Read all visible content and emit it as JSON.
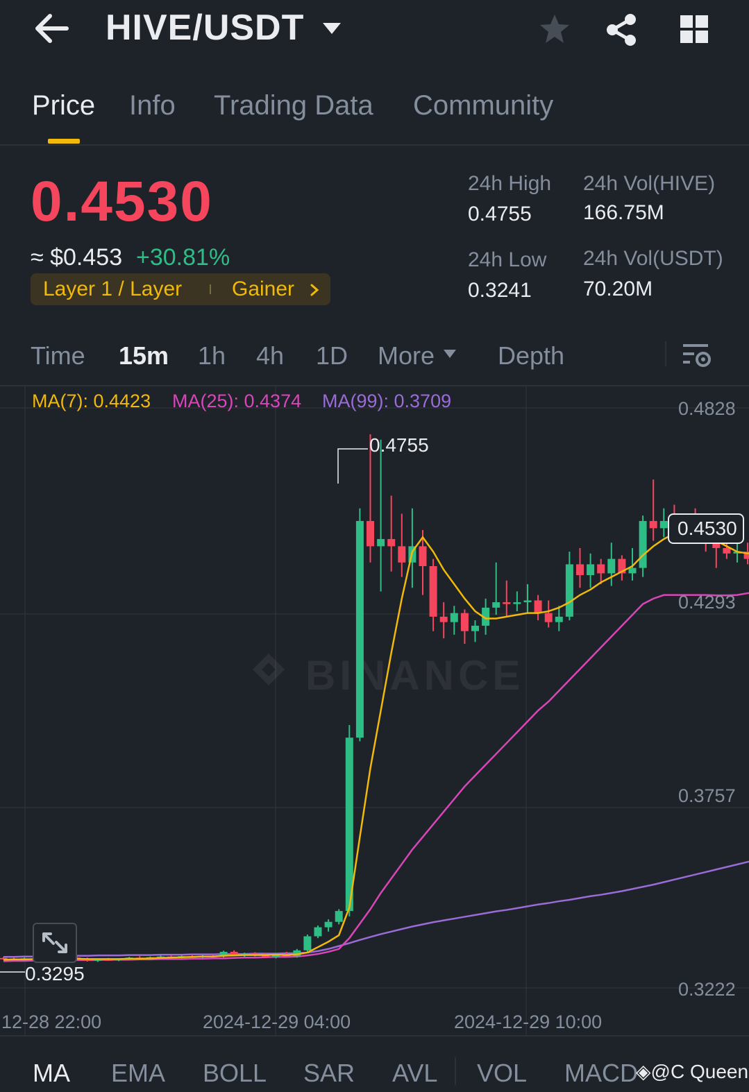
{
  "header": {
    "pair": "HIVE/USDT",
    "icons": [
      "back-arrow-icon",
      "caret-down-icon",
      "star-icon",
      "share-icon",
      "grid-icon"
    ]
  },
  "tabs": [
    {
      "label": "Price",
      "active": true
    },
    {
      "label": "Info",
      "active": false
    },
    {
      "label": "Trading Data",
      "active": false
    },
    {
      "label": "Community",
      "active": false
    }
  ],
  "price": {
    "last": "0.4530",
    "usd": "≈ $0.453",
    "change": "+30.81%",
    "tag1": "Layer 1 / Layer",
    "tag2": "Gainer"
  },
  "stats": {
    "high_label": "24h High",
    "high_value": "0.4755",
    "low_label": "24h Low",
    "low_value": "0.3241",
    "vol_base_label": "24h Vol(HIVE)",
    "vol_base_value": "166.75M",
    "vol_quote_label": "24h Vol(USDT)",
    "vol_quote_value": "70.20M"
  },
  "intervals": {
    "time": "Time",
    "m15": "15m",
    "h1": "1h",
    "h4": "4h",
    "d1": "1D",
    "more": "More",
    "depth": "Depth",
    "active": "15m"
  },
  "chart": {
    "ma7": "MA(7): 0.4423",
    "ma25": "MA(25): 0.4374",
    "ma99": "MA(99): 0.3709",
    "y_labels": [
      "0.4828",
      "0.4293",
      "0.3757",
      "0.3222"
    ],
    "x_labels": [
      "12-28 22:00",
      "2024-12-29 04:00",
      "2024-12-29 10:00"
    ],
    "current_price": "0.4530",
    "high_marker": "0.4755",
    "low_marker": "0.3295",
    "watermark": "BINANCE"
  },
  "chart_data": {
    "type": "candlestick",
    "interval": "15m",
    "ylim": [
      0.3222,
      0.4828
    ],
    "colors": {
      "up": "#2ebd85",
      "down": "#f6465d",
      "ma7": "#f0b90b",
      "ma25": "#d946b9",
      "ma99": "#9b6bd6"
    },
    "candles": [
      [
        0.3305,
        0.3308,
        0.33,
        0.3303
      ],
      [
        0.3303,
        0.3307,
        0.3299,
        0.3301
      ],
      [
        0.3301,
        0.3306,
        0.3298,
        0.3304
      ],
      [
        0.3304,
        0.3309,
        0.33,
        0.3302
      ],
      [
        0.3302,
        0.3306,
        0.3297,
        0.3299
      ],
      [
        0.3299,
        0.3305,
        0.3296,
        0.3303
      ],
      [
        0.3303,
        0.3308,
        0.33,
        0.3306
      ],
      [
        0.3306,
        0.331,
        0.33,
        0.3302
      ],
      [
        0.3302,
        0.3306,
        0.3295,
        0.3297
      ],
      [
        0.3297,
        0.3303,
        0.3294,
        0.3301
      ],
      [
        0.3301,
        0.3305,
        0.3297,
        0.3299
      ],
      [
        0.3299,
        0.3303,
        0.3296,
        0.3302
      ],
      [
        0.3302,
        0.3308,
        0.33,
        0.3306
      ],
      [
        0.3306,
        0.331,
        0.3302,
        0.3304
      ],
      [
        0.3304,
        0.3309,
        0.3301,
        0.3307
      ],
      [
        0.3307,
        0.3312,
        0.3303,
        0.3309
      ],
      [
        0.3309,
        0.3313,
        0.3305,
        0.3307
      ],
      [
        0.3307,
        0.3312,
        0.3304,
        0.331
      ],
      [
        0.331,
        0.3314,
        0.3306,
        0.3308
      ],
      [
        0.3308,
        0.3313,
        0.3305,
        0.3311
      ],
      [
        0.3311,
        0.3316,
        0.3307,
        0.3309
      ],
      [
        0.3309,
        0.3325,
        0.3306,
        0.3322
      ],
      [
        0.3322,
        0.3326,
        0.331,
        0.3314
      ],
      [
        0.3314,
        0.332,
        0.3308,
        0.3317
      ],
      [
        0.3317,
        0.3321,
        0.3309,
        0.3312
      ],
      [
        0.3312,
        0.3318,
        0.3305,
        0.3308
      ],
      [
        0.3308,
        0.3319,
        0.3304,
        0.3316
      ],
      [
        0.3316,
        0.3322,
        0.3306,
        0.331
      ],
      [
        0.331,
        0.333,
        0.3306,
        0.3326
      ],
      [
        0.3326,
        0.337,
        0.3322,
        0.3365
      ],
      [
        0.3365,
        0.3395,
        0.336,
        0.339
      ],
      [
        0.339,
        0.3412,
        0.3378,
        0.3405
      ],
      [
        0.3405,
        0.344,
        0.3398,
        0.3435
      ],
      [
        0.3435,
        0.395,
        0.342,
        0.3915
      ],
      [
        0.3915,
        0.455,
        0.3905,
        0.4515
      ],
      [
        0.4515,
        0.4755,
        0.44,
        0.4445
      ],
      [
        0.4445,
        0.474,
        0.432,
        0.4465
      ],
      [
        0.4465,
        0.4585,
        0.4375,
        0.4445
      ],
      [
        0.4445,
        0.4535,
        0.436,
        0.44
      ],
      [
        0.44,
        0.455,
        0.433,
        0.4445
      ],
      [
        0.4445,
        0.449,
        0.431,
        0.439
      ],
      [
        0.439,
        0.441,
        0.421,
        0.425
      ],
      [
        0.425,
        0.429,
        0.419,
        0.4235
      ],
      [
        0.4235,
        0.428,
        0.42,
        0.426
      ],
      [
        0.426,
        0.427,
        0.4175,
        0.421
      ],
      [
        0.421,
        0.424,
        0.418,
        0.4225
      ],
      [
        0.4225,
        0.43,
        0.42,
        0.4275
      ],
      [
        0.4275,
        0.44,
        0.4255,
        0.429
      ],
      [
        0.429,
        0.435,
        0.425,
        0.4285
      ],
      [
        0.4285,
        0.432,
        0.4265,
        0.429
      ],
      [
        0.429,
        0.434,
        0.426,
        0.4295
      ],
      [
        0.4295,
        0.431,
        0.424,
        0.426
      ],
      [
        0.426,
        0.4295,
        0.422,
        0.4235
      ],
      [
        0.4235,
        0.428,
        0.421,
        0.425
      ],
      [
        0.425,
        0.443,
        0.424,
        0.4395
      ],
      [
        0.4395,
        0.444,
        0.433,
        0.4365
      ],
      [
        0.4365,
        0.4425,
        0.433,
        0.4395
      ],
      [
        0.4395,
        0.441,
        0.434,
        0.437
      ],
      [
        0.437,
        0.4455,
        0.4335,
        0.441
      ],
      [
        0.441,
        0.442,
        0.435,
        0.437
      ],
      [
        0.437,
        0.444,
        0.435,
        0.4385
      ],
      [
        0.4385,
        0.453,
        0.436,
        0.4515
      ],
      [
        0.4515,
        0.463,
        0.446,
        0.4495
      ],
      [
        0.4495,
        0.455,
        0.447,
        0.4515
      ],
      [
        0.4515,
        0.456,
        0.4465,
        0.4495
      ],
      [
        0.4495,
        0.453,
        0.447,
        0.4505
      ],
      [
        0.4505,
        0.455,
        0.4485,
        0.449
      ],
      [
        0.449,
        0.452,
        0.443,
        0.446
      ],
      [
        0.446,
        0.448,
        0.4385,
        0.444
      ],
      [
        0.444,
        0.447,
        0.441,
        0.4425
      ],
      [
        0.4425,
        0.446,
        0.44,
        0.443
      ],
      [
        0.443,
        0.4455,
        0.4395,
        0.441
      ],
      [
        0.441,
        0.445,
        0.439,
        0.4435
      ],
      [
        0.4435,
        0.453,
        0.442,
        0.4465
      ],
      [
        0.4465,
        0.449,
        0.442,
        0.444
      ],
      [
        0.444,
        0.451,
        0.4425,
        0.448
      ],
      [
        0.448,
        0.454,
        0.4465,
        0.453
      ]
    ],
    "ma7_line": [
      0.33,
      0.3301,
      0.3301,
      0.3302,
      0.3302,
      0.3302,
      0.3303,
      0.3303,
      0.3302,
      0.3302,
      0.3302,
      0.3302,
      0.3303,
      0.3303,
      0.3304,
      0.3305,
      0.3306,
      0.3307,
      0.3308,
      0.3309,
      0.3309,
      0.3311,
      0.3312,
      0.3313,
      0.3313,
      0.3313,
      0.3314,
      0.3313,
      0.3315,
      0.332,
      0.3335,
      0.335,
      0.3368,
      0.3445,
      0.364,
      0.383,
      0.399,
      0.415,
      0.43,
      0.443,
      0.447,
      0.443,
      0.438,
      0.434,
      0.43,
      0.4265,
      0.4245,
      0.4245,
      0.425,
      0.4255,
      0.426,
      0.426,
      0.4265,
      0.4275,
      0.429,
      0.431,
      0.4325,
      0.4345,
      0.436,
      0.4375,
      0.439,
      0.442,
      0.4445,
      0.4465,
      0.448,
      0.449,
      0.4485,
      0.4475,
      0.446,
      0.4445,
      0.443,
      0.4425,
      0.443,
      0.4435,
      0.444,
      0.445
    ],
    "ma25_line": [
      0.3296,
      0.3297,
      0.3297,
      0.3298,
      0.3298,
      0.3298,
      0.3299,
      0.3299,
      0.3299,
      0.3299,
      0.33,
      0.33,
      0.33,
      0.3301,
      0.3301,
      0.3302,
      0.3302,
      0.3302,
      0.3303,
      0.3303,
      0.3304,
      0.3304,
      0.3305,
      0.3306,
      0.3306,
      0.3307,
      0.3308,
      0.3308,
      0.3309,
      0.3312,
      0.3316,
      0.3322,
      0.333,
      0.336,
      0.34,
      0.344,
      0.3485,
      0.3525,
      0.3565,
      0.3605,
      0.364,
      0.3675,
      0.371,
      0.3745,
      0.378,
      0.381,
      0.384,
      0.387,
      0.39,
      0.393,
      0.396,
      0.399,
      0.4015,
      0.4045,
      0.4075,
      0.4105,
      0.4135,
      0.4165,
      0.4195,
      0.4225,
      0.4255,
      0.4285,
      0.43,
      0.431,
      0.431,
      0.431,
      0.431,
      0.431,
      0.4309,
      0.4309,
      0.431,
      0.4315,
      0.4318,
      0.4325,
      0.4335,
      0.435
    ],
    "ma99_line": [
      0.3308,
      0.3308,
      0.3309,
      0.3309,
      0.331,
      0.331,
      0.3311,
      0.3311,
      0.3311,
      0.3312,
      0.3312,
      0.3312,
      0.3313,
      0.3313,
      0.3313,
      0.3314,
      0.3314,
      0.3314,
      0.3315,
      0.3315,
      0.3315,
      0.3316,
      0.3316,
      0.3316,
      0.3317,
      0.3317,
      0.3317,
      0.3318,
      0.3318,
      0.332,
      0.3324,
      0.333,
      0.3338,
      0.3346,
      0.3355,
      0.3363,
      0.3371,
      0.3378,
      0.3385,
      0.3392,
      0.3398,
      0.3404,
      0.3409,
      0.3414,
      0.3419,
      0.3424,
      0.3429,
      0.3434,
      0.3438,
      0.3443,
      0.3448,
      0.3453,
      0.3457,
      0.3462,
      0.3466,
      0.3471,
      0.3476,
      0.348,
      0.3485,
      0.349,
      0.3496,
      0.3502,
      0.3508,
      0.3515,
      0.3522,
      0.3529,
      0.3536,
      0.3543,
      0.355,
      0.3557,
      0.3564,
      0.3571,
      0.3578,
      0.3585,
      0.3592,
      0.36
    ]
  },
  "indicators": {
    "ma": "MA",
    "ema": "EMA",
    "boll": "BOLL",
    "sar": "SAR",
    "avl": "AVL",
    "vol": "VOL",
    "macd": "MACD",
    "tag": "@C Queen"
  }
}
